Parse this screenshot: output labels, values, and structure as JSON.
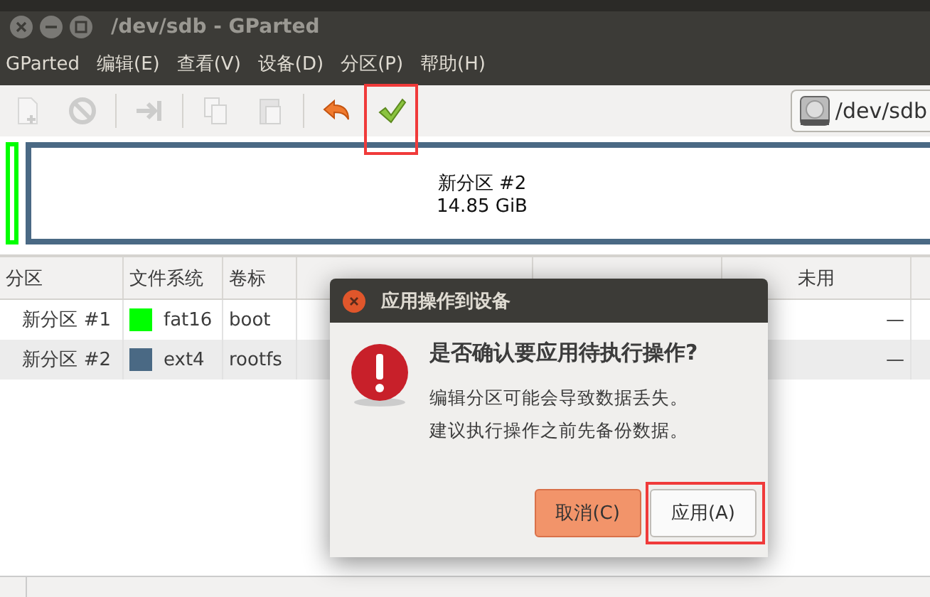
{
  "window": {
    "title": "/dev/sdb - GParted"
  },
  "menu": [
    {
      "label": "GParted"
    },
    {
      "label": "编辑(E)"
    },
    {
      "label": "查看(V)"
    },
    {
      "label": "设备(D)"
    },
    {
      "label": "分区(P)"
    },
    {
      "label": "帮助(H)"
    }
  ],
  "toolbar": [
    {
      "kind": "new",
      "disabled": true,
      "highlighted": false
    },
    {
      "kind": "delete",
      "disabled": true,
      "highlighted": false
    },
    {
      "kind": "sep"
    },
    {
      "kind": "resize",
      "disabled": true,
      "highlighted": false
    },
    {
      "kind": "sep"
    },
    {
      "kind": "copy",
      "disabled": true,
      "highlighted": false
    },
    {
      "kind": "paste",
      "disabled": true,
      "highlighted": false
    },
    {
      "kind": "sep"
    },
    {
      "kind": "undo",
      "disabled": false,
      "highlighted": false
    },
    {
      "kind": "apply",
      "disabled": false,
      "highlighted": true
    }
  ],
  "device": {
    "label": "/dev/sdb"
  },
  "graph": [
    {
      "color": "#00ff00"
    },
    {
      "color": "#4a6984",
      "name": "新分区 #2",
      "size": "14.85 GiB"
    }
  ],
  "table": {
    "columns": [
      {
        "label": "分区"
      },
      {
        "label": "文件系统"
      },
      {
        "label": "卷标"
      },
      {
        "label": "未用"
      }
    ],
    "rows": [
      {
        "partition": "新分区 #1",
        "color": "#00ff00",
        "filesystem": "fat16",
        "label": "boot",
        "unused": "—"
      },
      {
        "partition": "新分区 #2",
        "color": "#4a6984",
        "filesystem": "ext4",
        "label": "rootfs",
        "unused": "—"
      }
    ]
  },
  "dialog": {
    "title": "应用操作到设备",
    "heading": "是否确认要应用待执行操作?",
    "message": [
      "编辑分区可能会导致数据丢失。",
      "建议执行操作之前先备份数据。"
    ],
    "buttons": [
      {
        "label": "取消(C)",
        "kind": "default",
        "highlighted": false
      },
      {
        "label": "应用(A)",
        "kind": "normal",
        "highlighted": true
      }
    ]
  }
}
